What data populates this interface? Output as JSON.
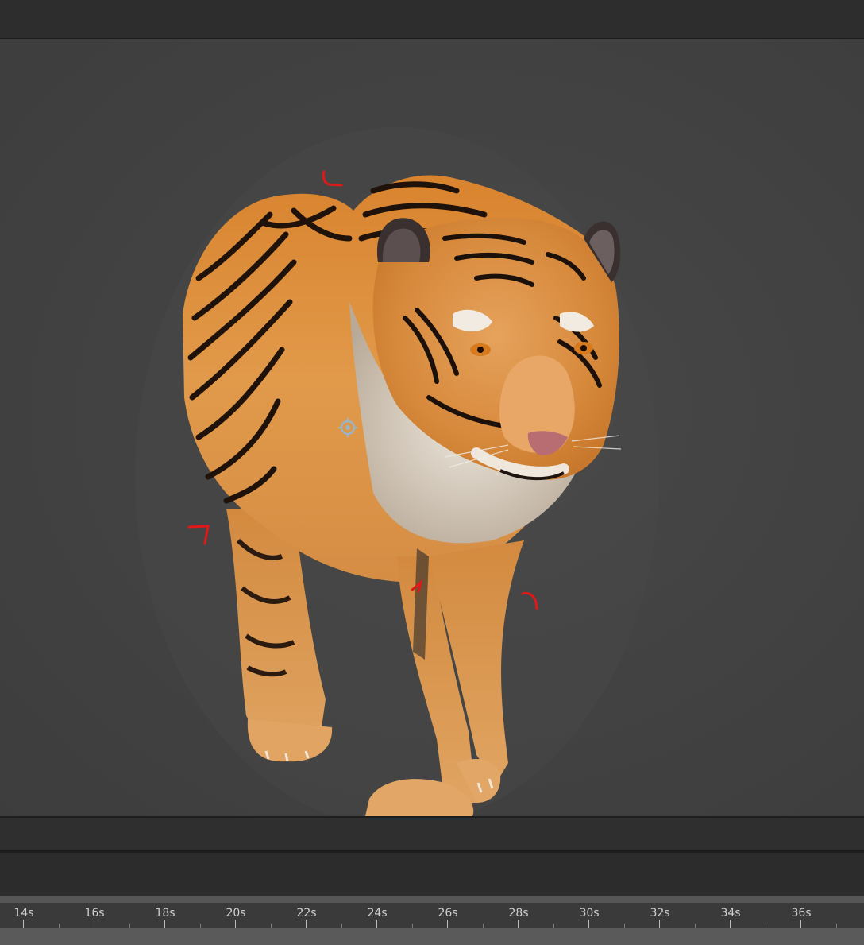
{
  "timeline": {
    "ticks": [
      "14s",
      "16s",
      "18s",
      "20s",
      "22s",
      "24s",
      "26s",
      "28s",
      "30s",
      "32s",
      "34s",
      "36s"
    ]
  },
  "colors": {
    "viewport_background": "#444444",
    "annotation_red": "#e01818",
    "gizmo": "#9ab4c8"
  },
  "icons": {
    "pivot_gizmo": "target-gizmo-icon"
  }
}
